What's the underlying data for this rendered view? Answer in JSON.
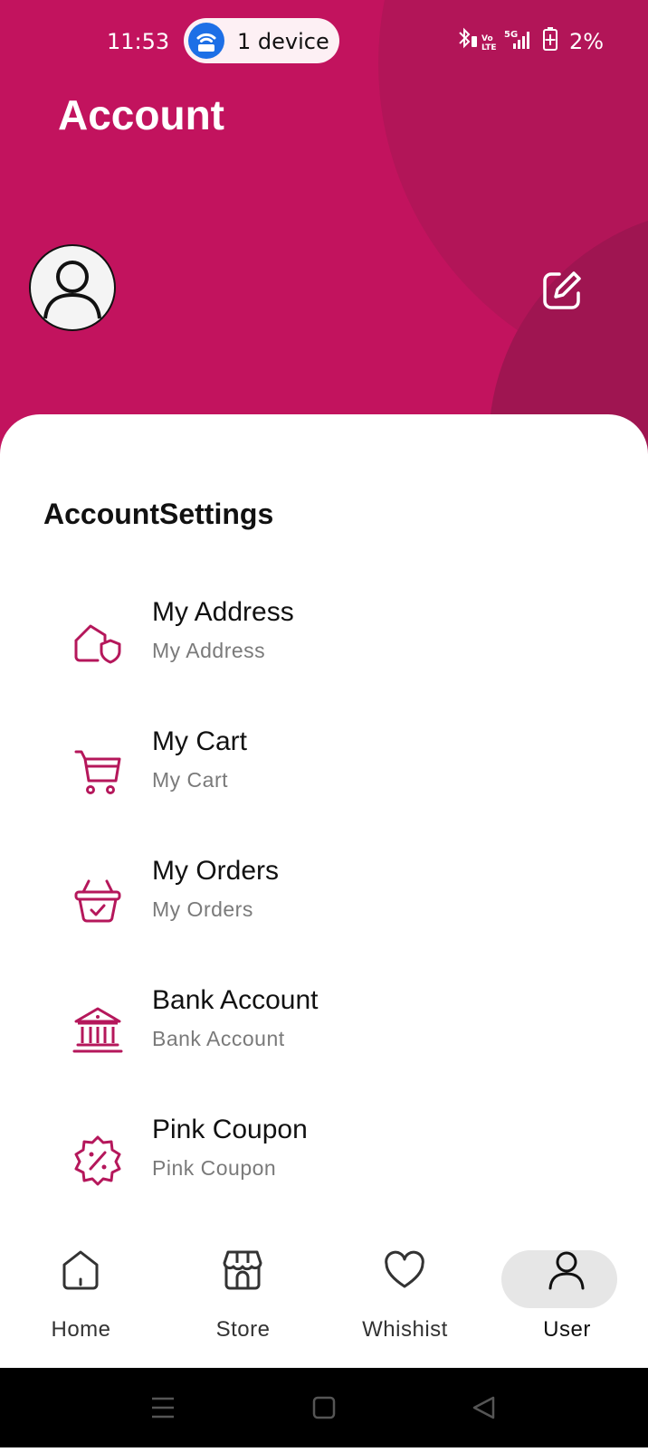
{
  "status_bar": {
    "time": "11:53",
    "hotspot_text": "1 device",
    "battery": "2%"
  },
  "header": {
    "title": "Account",
    "accent_color": "#c2135e"
  },
  "profile": {
    "avatar_icon": "user-avatar-icon",
    "edit_icon": "edit-icon"
  },
  "settings": {
    "title": "AccountSettings",
    "items": [
      {
        "title": "My Address",
        "subtitle": "My Address",
        "icon": "home-shield-icon"
      },
      {
        "title": "My Cart",
        "subtitle": "My Cart",
        "icon": "cart-icon"
      },
      {
        "title": "My Orders",
        "subtitle": "My Orders",
        "icon": "basket-check-icon"
      },
      {
        "title": "Bank Account",
        "subtitle": "Bank Account",
        "icon": "bank-icon"
      },
      {
        "title": "Pink Coupon",
        "subtitle": "Pink Coupon",
        "icon": "discount-badge-icon"
      }
    ]
  },
  "nav": {
    "items": [
      {
        "label": "Home",
        "icon": "home-icon",
        "active": false
      },
      {
        "label": "Store",
        "icon": "store-icon",
        "active": false
      },
      {
        "label": "Whishist",
        "icon": "heart-icon",
        "active": false
      },
      {
        "label": "User",
        "icon": "user-icon",
        "active": true
      }
    ]
  }
}
